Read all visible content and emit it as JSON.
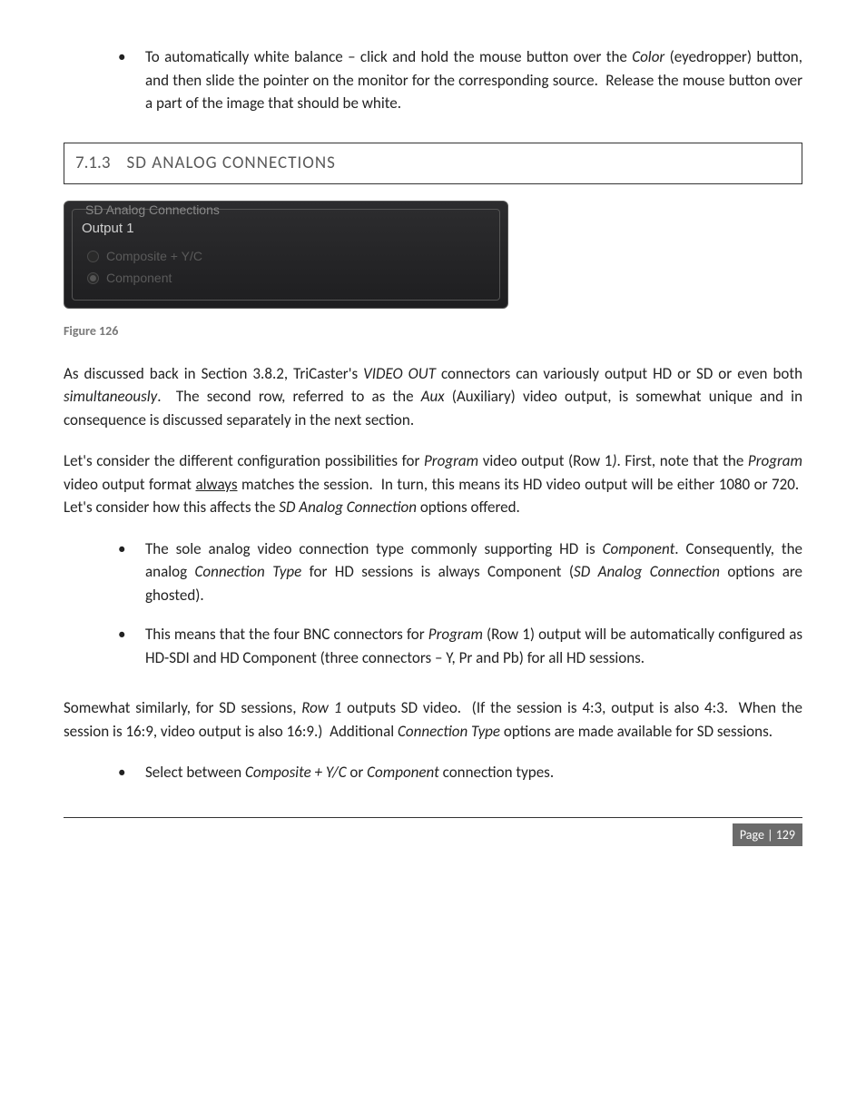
{
  "top_bullet": {
    "text_plain": "To automatically white balance – click and hold the mouse button over the Color (eyedropper) button, and then slide the pointer on the monitor for the corresponding source.  Release the mouse button over a part of the image that should be white."
  },
  "section": {
    "num": "7.1.3",
    "title": "SD ANALOG CONNECTIONS"
  },
  "panel": {
    "legend": "SD Analog Connections",
    "output": "Output 1",
    "opt1": "Composite + Y/C",
    "opt2": "Component"
  },
  "figcap": "Figure 126",
  "para1_plain": "As discussed back in Section 3.8.2, TriCaster's VIDEO OUT connectors can variously output HD or SD or even both simultaneously.  The second row, referred to as the Aux (Auxiliary) video output, is somewhat unique and in consequence is discussed separately in the next section.",
  "para2_plain": "Let's consider the different configuration possibilities for Program video output (Row 1). First, note that the Program video output format always matches the session.  In turn, this means its HD video output will be either 1080 or 720.  Let's consider how this affects the SD Analog Connection options offered.",
  "mid_bullets": {
    "b1_plain": "The sole analog video connection type commonly supporting HD is Component. Consequently, the analog Connection Type for HD sessions is always Component (SD Analog Connection options are ghosted).",
    "b2_plain": "This means that the four BNC connectors for Program (Row 1) output will be automatically configured as HD-SDI and HD Component (three connectors – Y, Pr and Pb) for all HD sessions."
  },
  "para3_plain": "Somewhat similarly, for SD sessions, Row 1 outputs SD video.  (If the session is 4:3, output is also 4:3.  When the session is 16:9, video output is also 16:9.)  Additional Connection Type options are made available for SD sessions.",
  "last_bullet_plain": "Select between Composite + Y/C or Component connection types.",
  "page": "Page | 129"
}
